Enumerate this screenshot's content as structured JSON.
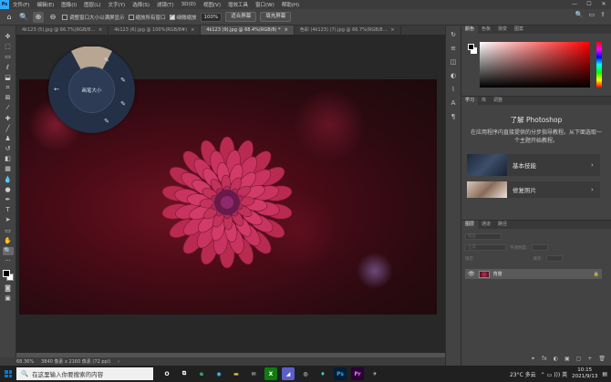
{
  "menubar": {
    "logo": "Ps",
    "items": [
      "文件(F)",
      "编辑(E)",
      "图像(I)",
      "图层(L)",
      "文字(Y)",
      "选择(S)",
      "滤镜(T)",
      "3D(D)",
      "视图(V)",
      "增效工具",
      "窗口(W)",
      "帮助(H)"
    ],
    "minimize": "—",
    "maximize": "☐",
    "close": "✕"
  },
  "optionsbar": {
    "resize_windows": "调整窗口大小以满屏显示",
    "zoom_all": "缩放所有窗口",
    "scrubby_zoom": "细微缩放",
    "zoom_value": "100%",
    "fit_screen": "适合屏幕",
    "fill_screen": "填充屏幕"
  },
  "doctabs": [
    {
      "label": "4k123 (5).jpg @ 66.7%(RGB/8...",
      "close": "×"
    },
    {
      "label": "4k123 (6).jpg @ 100%(RGB/8#)",
      "close": "×"
    },
    {
      "label": "4k123 (9).jpg @ 68.4%(RGB/8) *",
      "close": "×"
    },
    {
      "label": "色彩 (4k123) (7).jpg @ 66.7%(RGB/8...",
      "close": "×"
    }
  ],
  "radial": {
    "label": "画笔大小",
    "back": "←"
  },
  "statusbar": {
    "zoom": "68.36%",
    "doc_info": "3840 像素 x 2160 像素 (72 ppi)",
    "arrow": "›"
  },
  "panels": {
    "color_tabs": [
      "颜色",
      "色板",
      "渐变",
      "图案"
    ],
    "learn_tabs": [
      "学习",
      "库",
      "调整"
    ],
    "learn_title": "了解 Photoshop",
    "learn_desc": "在应用程序内直接提供的分步指导教程。从下面选取一个主题开始教程。",
    "cards": [
      {
        "label": "基本技能",
        "arrow": "›"
      },
      {
        "label": "修复照片",
        "arrow": "›"
      }
    ],
    "layers_tabs": [
      "图层",
      "通道",
      "路径"
    ],
    "layer_kind": "类型",
    "blend_mode": "正常",
    "opacity_label": "不透明度:",
    "lock_label": "锁定:",
    "fill_label": "填充:",
    "layer_name": "背景",
    "footer_icons": [
      "fx",
      "◐",
      "▣",
      "▢",
      "+",
      "🗑"
    ]
  },
  "taskbar": {
    "search_placeholder": "在这里输入你要搜索的内容",
    "apps": [
      {
        "name": "O",
        "color": "#ffffff",
        "bg": "transparent"
      },
      {
        "name": "⧉",
        "color": "#ffffff",
        "bg": "transparent"
      },
      {
        "name": "e",
        "color": "#3ddc84",
        "bg": "transparent"
      },
      {
        "name": "◉",
        "color": "#4fc3f7",
        "bg": "transparent"
      },
      {
        "name": "▬",
        "color": "#f4c542",
        "bg": "transparent"
      },
      {
        "name": "✉",
        "color": "#cfcfcf",
        "bg": "transparent"
      },
      {
        "name": "X",
        "color": "#ffffff",
        "bg": "#107c10"
      },
      {
        "name": "◢",
        "color": "#ffffff",
        "bg": "#5b5fc7"
      },
      {
        "name": "◎",
        "color": "#ffffff",
        "bg": "transparent"
      },
      {
        "name": "♦",
        "color": "#4ecdc4",
        "bg": "transparent"
      },
      {
        "name": "Ps",
        "color": "#31a8ff",
        "bg": "#001e36"
      },
      {
        "name": "Pr",
        "color": "#ea77ff",
        "bg": "#2b0034"
      },
      {
        "name": "✈",
        "color": "#cfcfcf",
        "bg": "transparent"
      }
    ],
    "weather": "23°C 多云",
    "tray_icons": "⌃ ▭ ))) 英",
    "time": "10:15",
    "date": "2021/9/13",
    "notify": "▤"
  },
  "colors": {
    "ps_blue": "#31a8ff",
    "flower": "#c2325a",
    "background": "#535353"
  }
}
